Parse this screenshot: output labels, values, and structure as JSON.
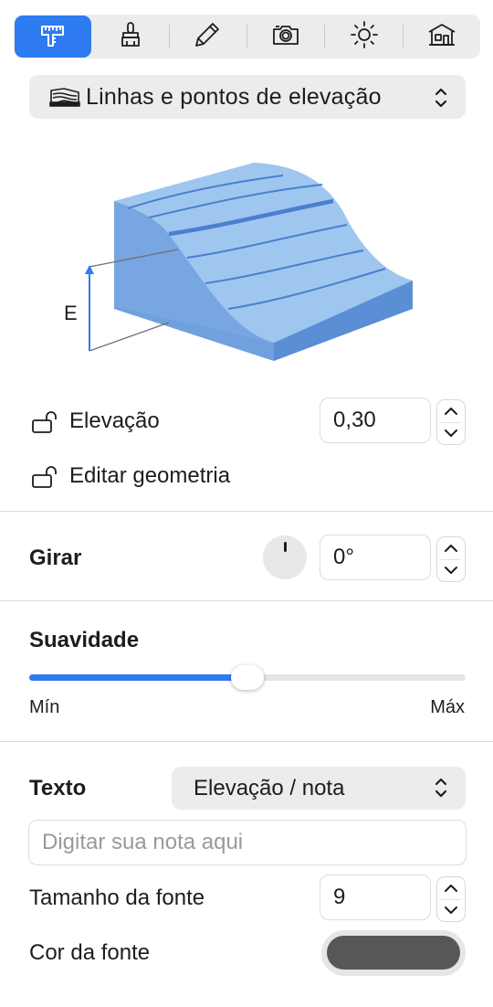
{
  "toolbar": {
    "tabs": [
      {
        "name": "measure-tool",
        "icon": "ruler-gauge-icon",
        "active": true
      },
      {
        "name": "brush-tool",
        "icon": "brush-icon",
        "active": false
      },
      {
        "name": "pencil-tool",
        "icon": "pencil-icon",
        "active": false
      },
      {
        "name": "camera-tool",
        "icon": "camera-icon",
        "active": false
      },
      {
        "name": "sun-tool",
        "icon": "sun-icon",
        "active": false
      },
      {
        "name": "building-tool",
        "icon": "building-icon",
        "active": false
      }
    ],
    "accent_color": "#2f7bf0"
  },
  "mode_select": {
    "icon": "elevation-lines-icon",
    "selected": "Linhas e pontos de elevação"
  },
  "illustration": {
    "label": "E",
    "colors": {
      "top": "#9ec6ef",
      "front": "#5a8fd6",
      "side": "#78a6e2",
      "lines": "#4a7fcf"
    }
  },
  "elevation": {
    "label": "Elevação",
    "value": "0,30",
    "lock_icon": "unlocked-lock-icon"
  },
  "edit_geometry": {
    "label": "Editar geometria",
    "lock_icon": "unlocked-lock-icon"
  },
  "rotate": {
    "label": "Girar",
    "value": "0°"
  },
  "smoothness": {
    "title": "Suavidade",
    "min_label": "Mín",
    "max_label": "Máx",
    "level": 0.5
  },
  "text": {
    "label": "Texto",
    "selected": "Elevação / nota",
    "placeholder": "Digitar sua nota aqui"
  },
  "font_size": {
    "label": "Tamanho da fonte",
    "value": "9"
  },
  "font_color": {
    "label": "Cor da fonte",
    "color": "#575757"
  }
}
